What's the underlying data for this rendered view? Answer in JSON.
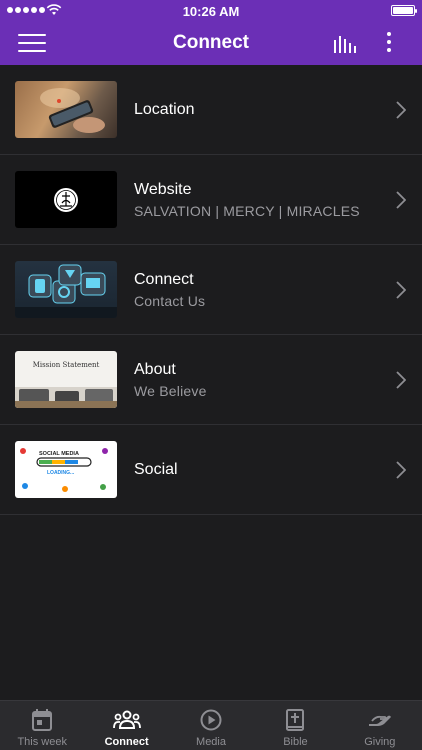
{
  "status_bar": {
    "time": "10:26 AM"
  },
  "nav": {
    "title": "Connect"
  },
  "items": [
    {
      "label": "Location",
      "subtitle": ""
    },
    {
      "label": "Website",
      "subtitle": "SALVATION | MERCY | MIRACLES"
    },
    {
      "label": "Connect",
      "subtitle": "Contact Us"
    },
    {
      "label": "About",
      "subtitle": "We Believe"
    },
    {
      "label": "Social",
      "subtitle": ""
    }
  ],
  "thumbnails": {
    "about_text": "Mission Statement",
    "social_text": "SOCIAL MEDIA",
    "social_loading": "LOADING..."
  },
  "tabs": [
    {
      "label": "This week",
      "icon": "calendar-icon"
    },
    {
      "label": "Connect",
      "icon": "people-icon",
      "active": true
    },
    {
      "label": "Media",
      "icon": "play-icon"
    },
    {
      "label": "Bible",
      "icon": "bible-icon"
    },
    {
      "label": "Giving",
      "icon": "giving-hand-icon"
    }
  ],
  "colors": {
    "brand": "#6b2fb6",
    "background": "#1c1c1e",
    "tabbar": "#2b2b2e"
  }
}
